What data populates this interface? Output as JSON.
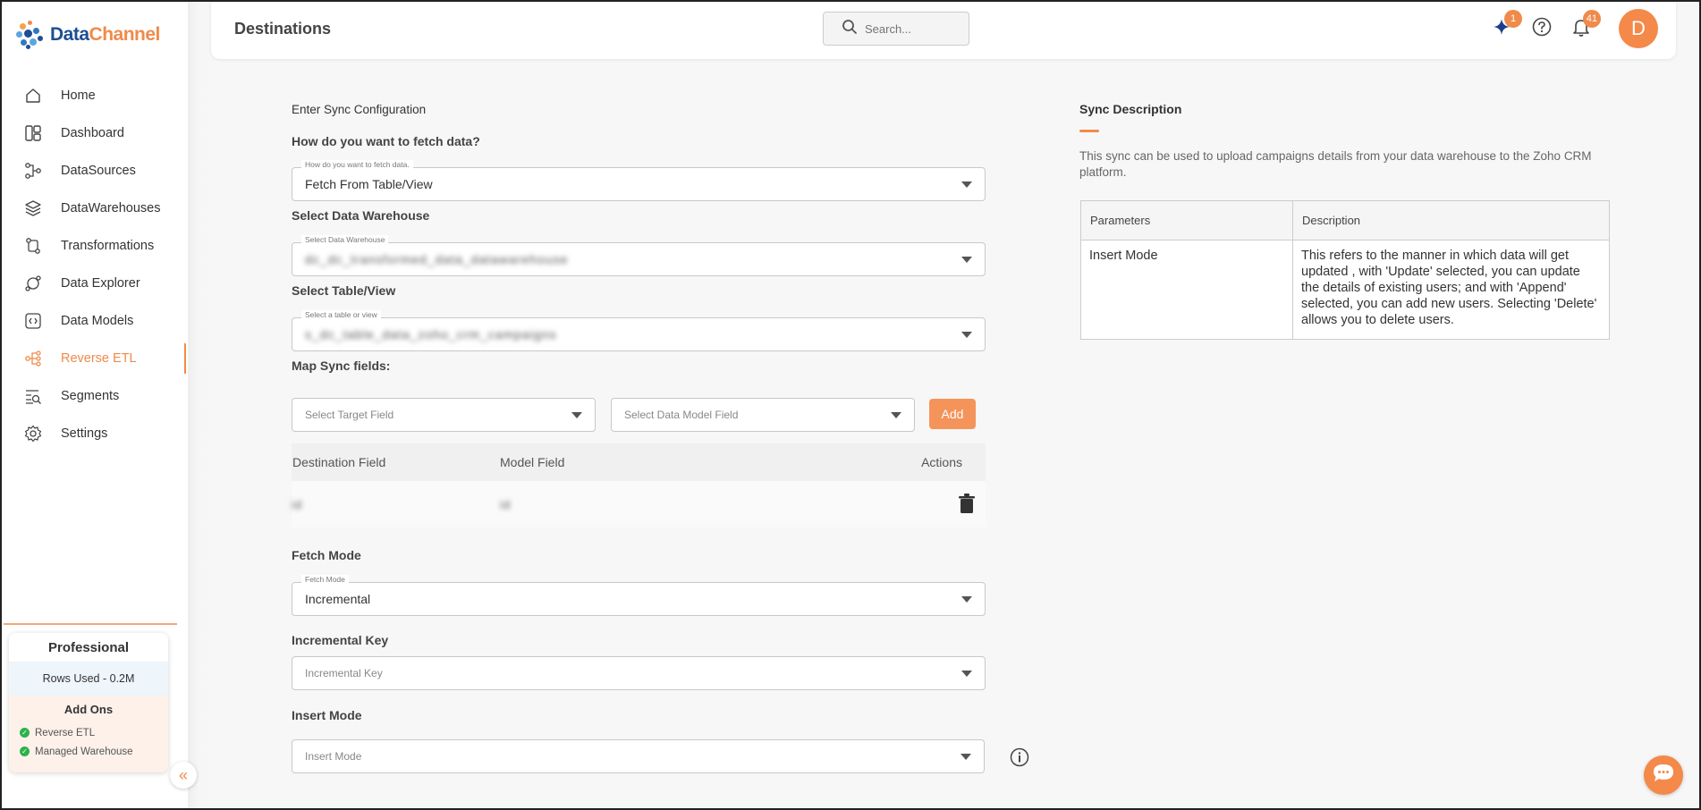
{
  "app": {
    "logo_part1": "Data",
    "logo_part2": "Channel"
  },
  "sidebar": {
    "items": [
      {
        "label": "Home",
        "icon": "home-icon"
      },
      {
        "label": "Dashboard",
        "icon": "dashboard-icon"
      },
      {
        "label": "DataSources",
        "icon": "datasources-icon"
      },
      {
        "label": "DataWarehouses",
        "icon": "datawarehouses-icon"
      },
      {
        "label": "Transformations",
        "icon": "transformations-icon"
      },
      {
        "label": "Data Explorer",
        "icon": "data-explorer-icon"
      },
      {
        "label": "Data Models",
        "icon": "data-models-icon"
      },
      {
        "label": "Reverse ETL",
        "icon": "reverse-etl-icon",
        "active": true
      },
      {
        "label": "Segments",
        "icon": "segments-icon"
      },
      {
        "label": "Settings",
        "icon": "settings-icon"
      }
    ],
    "plan": {
      "name": "Professional",
      "rows_used": "Rows Used - 0.2M",
      "addons_title": "Add Ons",
      "addons": [
        "Reverse ETL",
        "Managed Warehouse"
      ]
    }
  },
  "header": {
    "title": "Destinations",
    "search_placeholder": "Search...",
    "ai_badge": "1",
    "notifications_badge": "41",
    "avatar_initial": "D"
  },
  "form": {
    "section_title": "Enter Sync Configuration",
    "fetch_question": "How do you want to fetch data?",
    "fetch_legend": "How do you want to fetch data.",
    "fetch_value": "Fetch From Table/View",
    "warehouse_label": "Select Data Warehouse",
    "warehouse_legend": "Select Data Warehouse",
    "warehouse_value": "dc_dc_transformed_data_datawarehouse",
    "table_label": "Select Table/View",
    "table_legend": "Select a table or view",
    "table_value": "s_dc_table_data_zoho_crm_campaigns",
    "map_label": "Map Sync fields:",
    "target_placeholder": "Select Target Field",
    "model_placeholder": "Select Data Model Field",
    "add_label": "Add",
    "map_table": {
      "columns": [
        "Destination Field",
        "Model Field",
        "Actions"
      ],
      "rows": [
        {
          "destination": "id",
          "model": "id"
        }
      ]
    },
    "fetch_mode_label": "Fetch Mode",
    "fetch_mode_legend": "Fetch Mode",
    "fetch_mode_value": "Incremental",
    "incremental_key_label": "Incremental Key",
    "incremental_key_placeholder": "Incremental Key",
    "insert_mode_label": "Insert Mode",
    "insert_mode_placeholder": "Insert Mode"
  },
  "description": {
    "title": "Sync Description",
    "text": "This sync can be used to upload campaigns details from your data warehouse to the Zoho CRM platform.",
    "table": {
      "headers": [
        "Parameters",
        "Description"
      ],
      "rows": [
        {
          "param": "Insert Mode",
          "desc": "This refers to the manner in which data will get updated , with 'Update' selected, you can update the details of existing users; and with 'Append' selected, you can add new users. Selecting 'Delete' allows you to delete users."
        }
      ]
    }
  },
  "colors": {
    "accent": "#f08a4b",
    "brand_blue": "#1d4f91"
  }
}
